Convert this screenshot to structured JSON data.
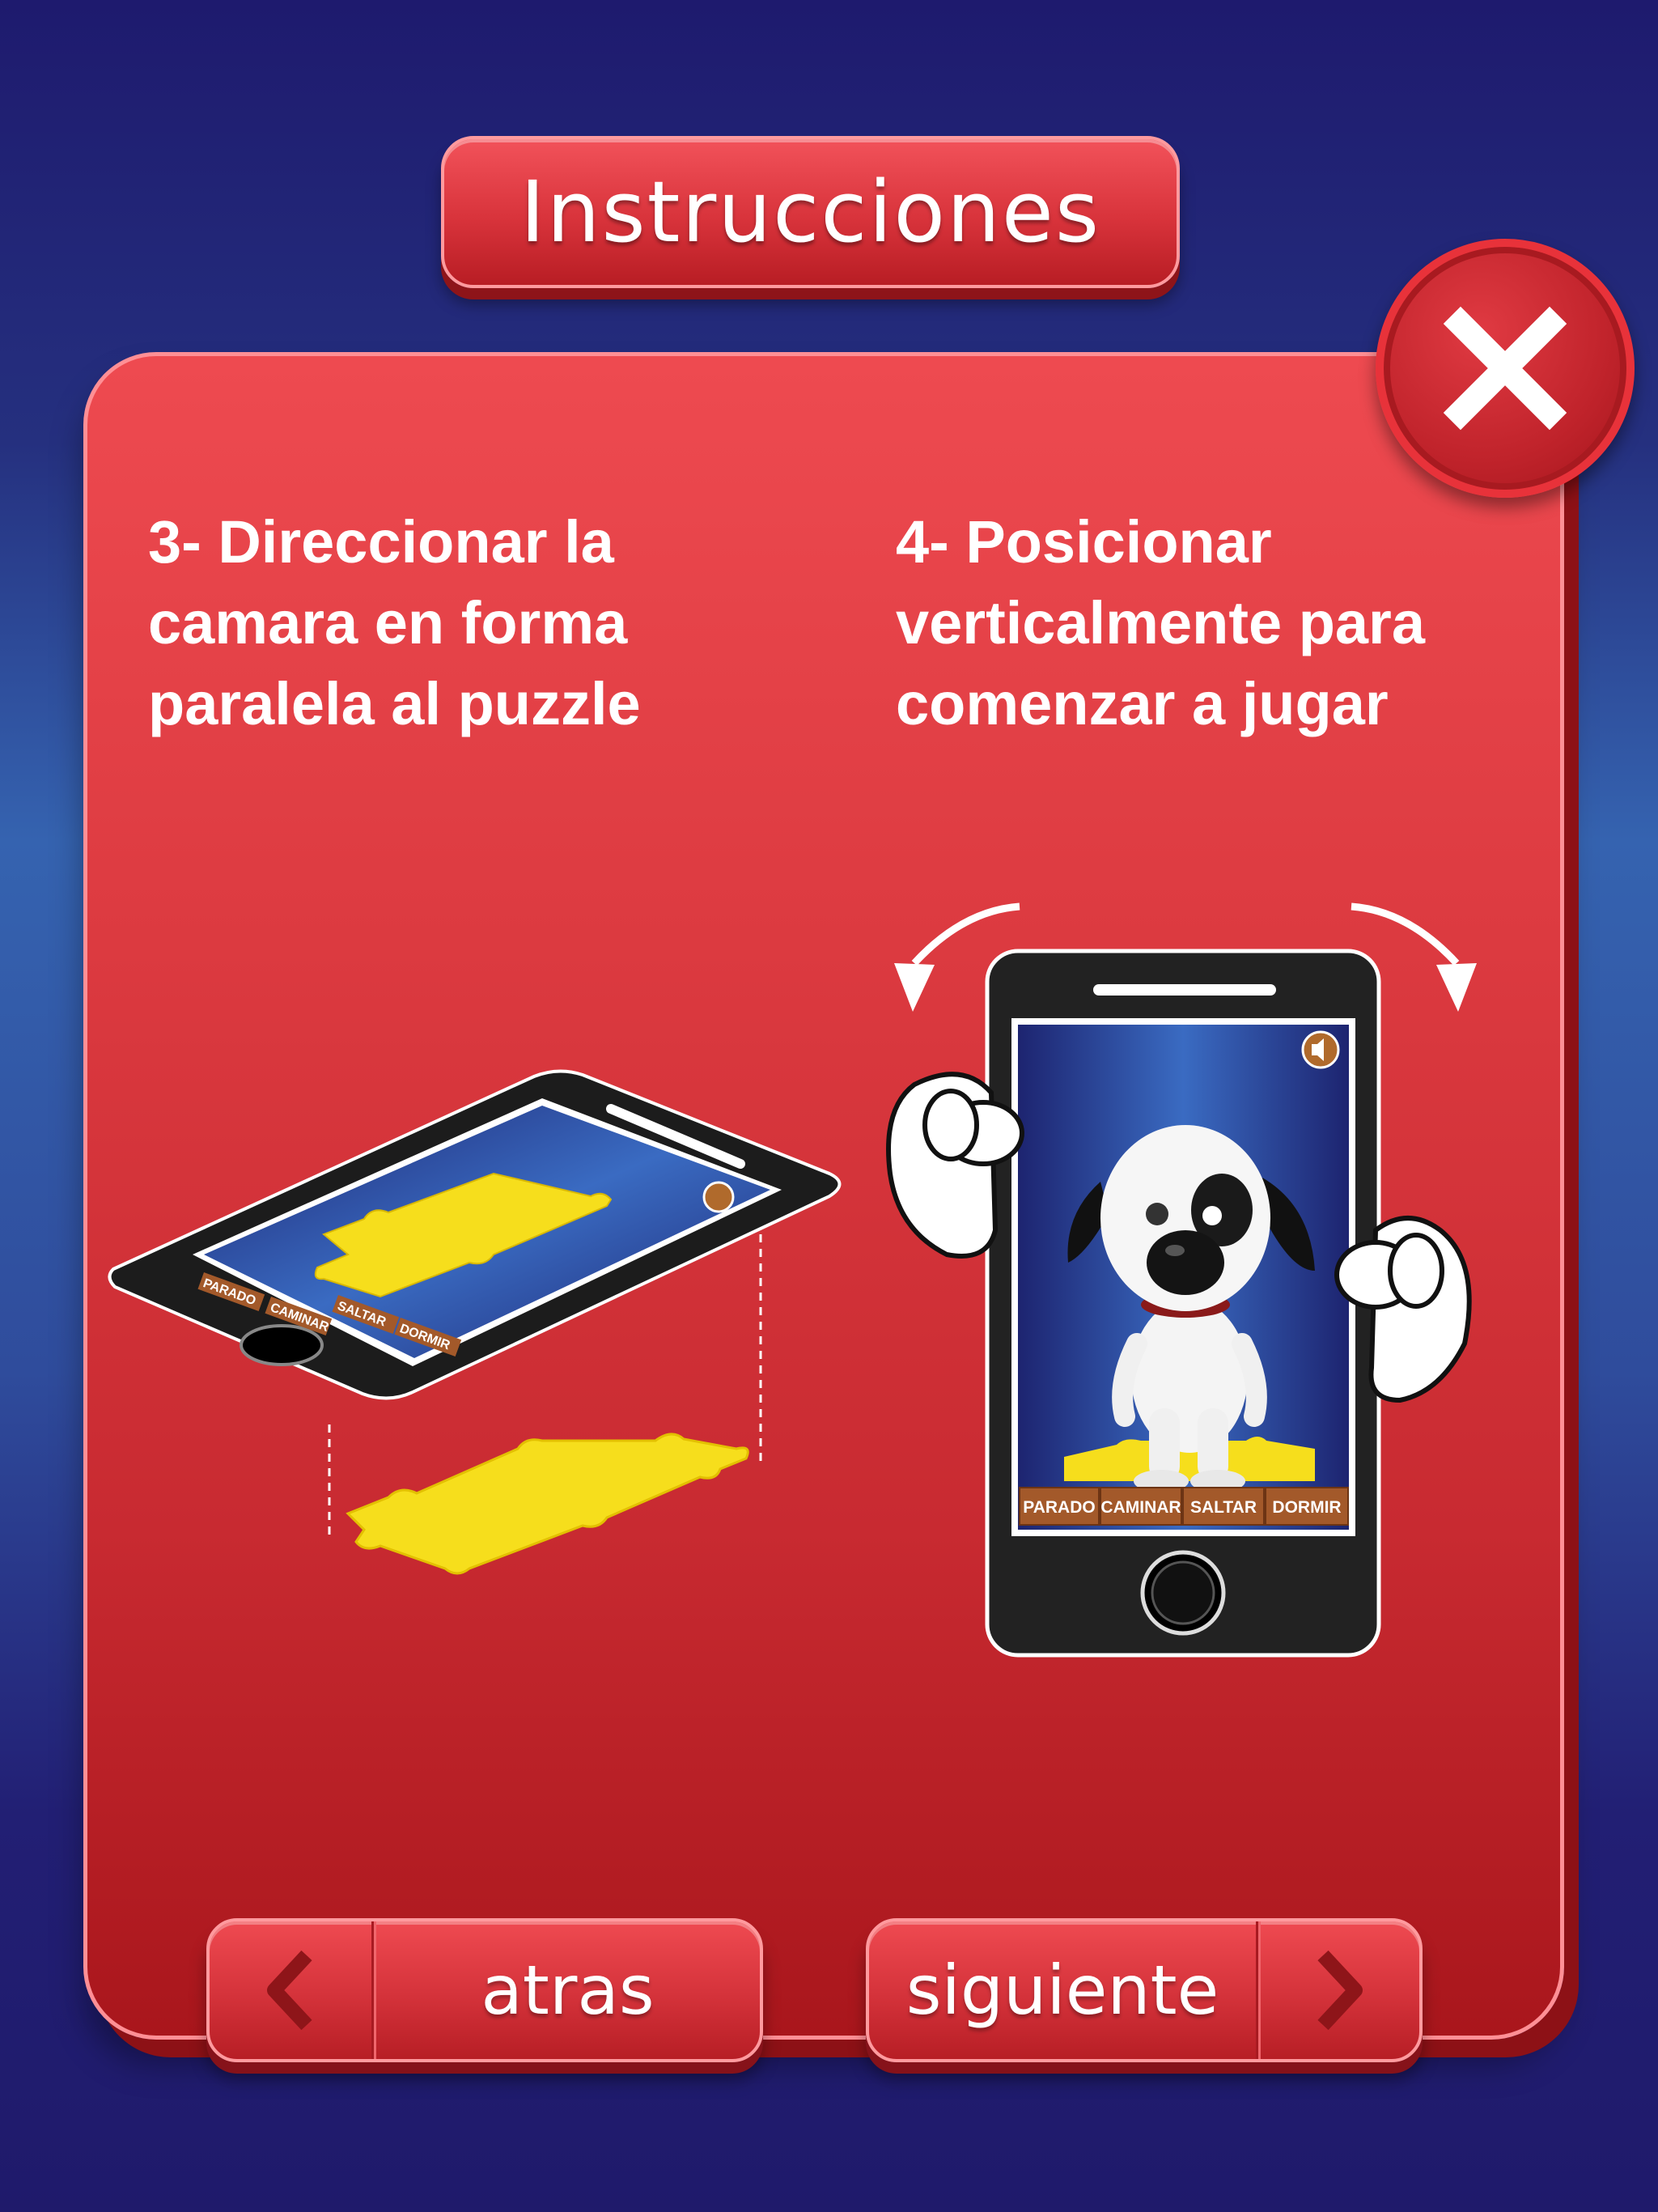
{
  "header": {
    "title": "Instrucciones"
  },
  "close": {
    "icon": "close-icon"
  },
  "steps": [
    {
      "lines": [
        "3- Direccionar la",
        "camara en forma",
        "paralela al puzzle"
      ]
    },
    {
      "lines": [
        "4- Posicionar",
        "verticalmente para",
        "comenzar a jugar"
      ]
    }
  ],
  "game_ui": {
    "buttons": [
      "PARADO",
      "CAMINAR",
      "SALTAR",
      "DORMIR"
    ],
    "sound_icon": "speaker-icon"
  },
  "nav": {
    "back_label": "atras",
    "next_label": "siguiente",
    "back_icon": "chevron-left-icon",
    "next_icon": "chevron-right-icon"
  },
  "colors": {
    "background": "#1f1a6b",
    "panel": "#dc3a40",
    "puzzle": "#f6de1c",
    "phone": "#222222"
  }
}
